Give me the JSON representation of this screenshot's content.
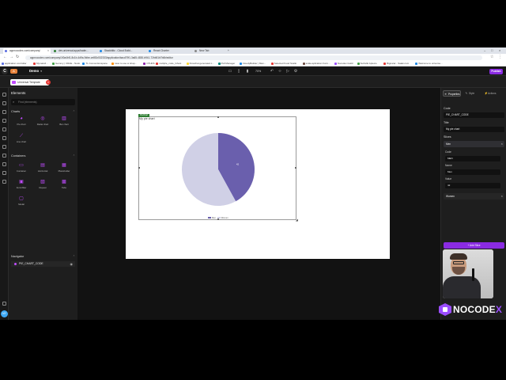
{
  "browser": {
    "tabs": [
      {
        "label": "appnocodex.com/company/",
        "color": "#5b6ee1"
      },
      {
        "label": "dev.universal.apps/hadm...",
        "color": "#2e7d32"
      },
      {
        "label": "Stackblitz - Cloud Build...",
        "color": "#1e88e5"
      },
      {
        "label": "React Charter",
        "color": "#1e88e5"
      },
      {
        "label": "New Tab",
        "color": "#888888"
      }
    ],
    "url": "appnocodex.com/company/1f0a4bf1-8c1b-4d9a-9dbe-ce8f2c532333/application/bacd79f1-3a65-4830-b941-72bb51b7b6b/editor",
    "bookmarks": [
      {
        "label": "application controller",
        "color": "#5b6ee1"
      },
      {
        "label": "Mymatvd...",
        "color": "#e53935"
      },
      {
        "label": "Gemmy | CRAE - Nodo",
        "color": "#43a047"
      },
      {
        "label": "TL Conventionspane",
        "color": "#1e88e5"
      },
      {
        "label": "How to use w shap...",
        "color": "#fb8c00"
      },
      {
        "label": "OTHDS",
        "color": "#8e24aa"
      },
      {
        "label": "multiple_code_Ghost",
        "color": "#e53935"
      },
      {
        "label": "Flowchat generated c...",
        "color": "#fdd835"
      },
      {
        "label": "Pull Manager",
        "color": "#00897b"
      },
      {
        "label": "CloudyBuilder | Man...",
        "color": "#1e88e5"
      },
      {
        "label": "Selected Food Scallo",
        "color": "#e53935"
      },
      {
        "label": "scala aplication Form...",
        "color": "#6d4c41"
      },
      {
        "label": "Nocodex.Guild",
        "color": "#9b4dff"
      },
      {
        "label": "Surfwiki Aplexio",
        "color": "#43a047"
      },
      {
        "label": "Bignarar - Saaki.com",
        "color": "#e53935"
      },
      {
        "label": "Welcome to universe...",
        "color": "#1e88e5"
      }
    ]
  },
  "app": {
    "logo": "C",
    "project_badge": "A",
    "app_name": "Demo",
    "zoom": "70%",
    "publish_label": "Publish",
    "page_tab_label": "Universal Template"
  },
  "left_panel": {
    "title": "Elements",
    "search_placeholder": "Find (elements)",
    "charts_header": "Charts",
    "charts": [
      {
        "label": "Pie chart",
        "icon": "pie-chart-icon"
      },
      {
        "label": "Radar chart",
        "icon": "radar-chart-icon"
      },
      {
        "label": "Bar chart",
        "icon": "bar-chart-icon"
      },
      {
        "label": "Line chart",
        "icon": "line-chart-icon"
      }
    ],
    "containers_header": "Containers",
    "containers": [
      {
        "label": "Container",
        "icon": "container-icon"
      },
      {
        "label": "Horizontal",
        "icon": "horizontal-icon"
      },
      {
        "label": "Placeholder",
        "icon": "placeholder-icon"
      },
      {
        "label": "Form/filter",
        "icon": "form-icon"
      },
      {
        "label": "Repeat",
        "icon": "repeat-icon"
      },
      {
        "label": "Tabs",
        "icon": "tabs-icon"
      },
      {
        "label": "Modal",
        "icon": "modal-icon"
      }
    ],
    "navigator_header": "Navigator",
    "navigator_item": "PIE_CHART_CODE"
  },
  "canvas": {
    "element_badge": "PieChart",
    "chart_title": "My pie chart",
    "legend": [
      {
        "name": "Men",
        "color": "#6a5fad"
      },
      {
        "name": "Women",
        "color": "#d0d0e6"
      }
    ]
  },
  "chart_data": {
    "type": "pie",
    "title": "My pie chart",
    "categories": [
      "Men",
      "Women"
    ],
    "values": [
      42,
      58
    ],
    "colors": [
      "#6a5fad",
      "#d0d0e6"
    ],
    "slice_label": "42"
  },
  "right_panel": {
    "tabs": [
      "Properties",
      "Style",
      "Actions"
    ],
    "code_label": "Code",
    "code_value": "PIE_CHART_CODE",
    "title_label": "Title",
    "title_value": "My pie chart",
    "slices_label": "Slices",
    "slices": [
      {
        "header": "Men",
        "code_label": "Code",
        "code_value": "MEN",
        "name_label": "Name",
        "name_value": "Men",
        "value_label": "Value",
        "value_value": "42"
      },
      {
        "header": "Women"
      }
    ],
    "add_slice_label": "+ Add Slice"
  },
  "brand": {
    "name": "NOCODE",
    "accent": "X"
  }
}
